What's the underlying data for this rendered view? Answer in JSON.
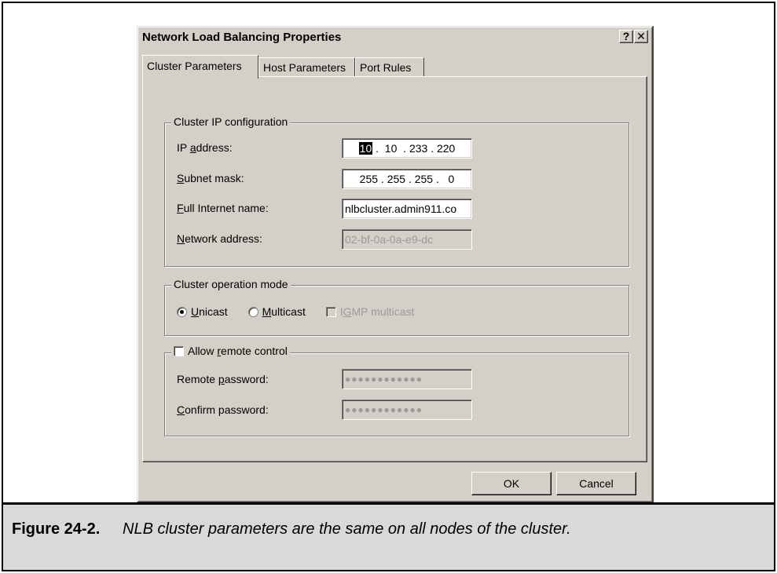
{
  "dialog": {
    "title": "Network Load Balancing Properties",
    "help_label": "?",
    "close_label": "✕"
  },
  "tabs": [
    {
      "label": "Cluster Parameters",
      "active": true
    },
    {
      "label": "Host Parameters",
      "active": false
    },
    {
      "label": "Port Rules",
      "active": false
    }
  ],
  "cluster_ip": {
    "legend": "Cluster IP configuration",
    "ip_label_pre": "IP ",
    "ip_label_key": "a",
    "ip_label_post": "ddress:",
    "ip_first_octet": "10",
    "ip_rest": " .  10  . 233 . 220",
    "subnet_label_key": "S",
    "subnet_label_post": "ubnet mask:",
    "subnet_value": "255 . 255 . 255 .   0",
    "fullname_label_key": "F",
    "fullname_label_post": "ull Internet name:",
    "fullname_value": "nlbcluster.admin911.co",
    "network_label_key": "N",
    "network_label_post": "etwork address:",
    "network_value": "02-bf-0a-0a-e9-dc"
  },
  "operation_mode": {
    "legend": "Cluster operation mode",
    "unicast_key": "U",
    "unicast_post": "nicast",
    "multicast_key": "M",
    "multicast_post": "ulticast",
    "igmp_pre": "I",
    "igmp_key": "G",
    "igmp_post": "MP multicast",
    "selected": "unicast"
  },
  "remote": {
    "legend_pre": "Allow ",
    "legend_key": "r",
    "legend_post": "emote control",
    "password_label_pre": "Remote ",
    "password_label_key": "p",
    "password_label_post": "assword:",
    "password_value": "●●●●●●●●●●●●",
    "confirm_label_key": "C",
    "confirm_label_post": "onfirm password:",
    "confirm_value": "●●●●●●●●●●●●"
  },
  "buttons": {
    "ok": "OK",
    "cancel": "Cancel"
  },
  "caption": {
    "number": "Figure 24-2.",
    "text": "NLB cluster parameters are the same on all nodes of the cluster."
  },
  "colors": {
    "dialog_bg": "#d4d0c8",
    "caption_bg": "#d9d9d9"
  }
}
